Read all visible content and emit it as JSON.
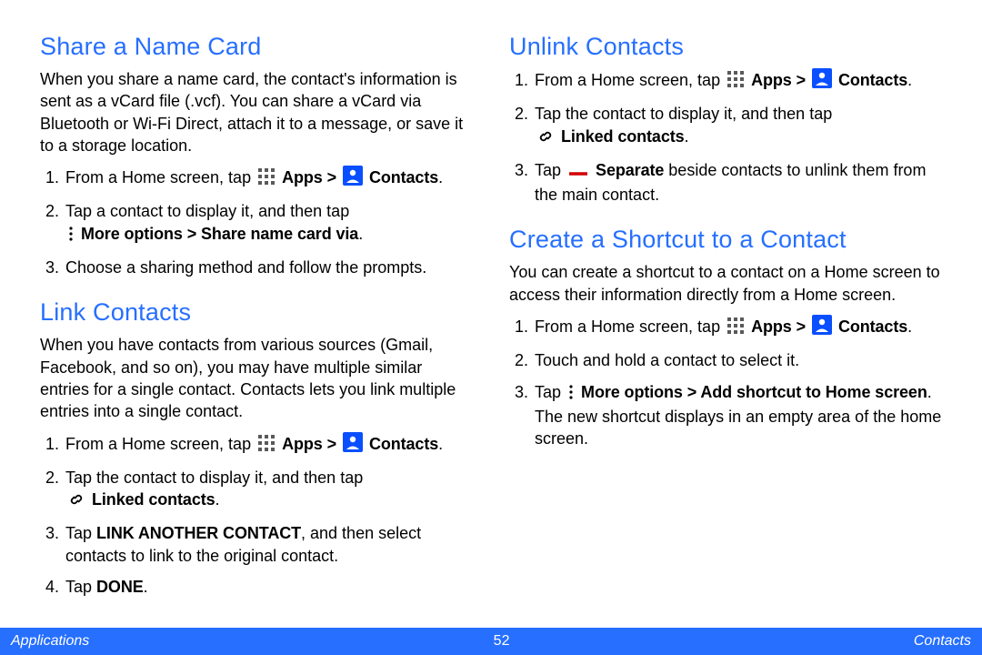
{
  "left": {
    "share": {
      "heading": "Share a Name Card",
      "intro": "When you share a name card, the contact's information is sent as a vCard file (.vcf). You can share a vCard via Bluetooth or Wi-Fi Direct, attach it to a message, or save it to a storage location.",
      "s1_a": "From a Home screen, tap ",
      "s1_b": "Apps > ",
      "s1_c": "Contacts",
      "s1_d": ".",
      "s2_a": "Tap a contact to display it, and then tap ",
      "s2_b": "More options > Share name card via",
      "s2_c": ".",
      "s3": "Choose a sharing method and follow the prompts."
    },
    "link": {
      "heading": "Link Contacts",
      "intro": "When you have contacts from various sources (Gmail, Facebook, and so on), you may have multiple similar entries for a single contact. Contacts lets you link multiple entries into a single contact.",
      "s1_a": "From a Home screen, tap ",
      "s1_b": "Apps > ",
      "s1_c": "Contacts",
      "s1_d": ".",
      "s2_a": "Tap the contact to display it, and then tap ",
      "s2_b": "Linked contacts",
      "s2_c": ".",
      "s3_a": "Tap ",
      "s3_b": "LINK ANOTHER CONTACT",
      "s3_c": ", and then select contacts to link to the original contact.",
      "s4_a": "Tap ",
      "s4_b": "DONE",
      "s4_c": "."
    }
  },
  "right": {
    "unlink": {
      "heading": "Unlink Contacts",
      "s1_a": "From a Home screen, tap ",
      "s1_b": "Apps > ",
      "s1_c": "Contacts",
      "s1_d": ".",
      "s2_a": "Tap the contact to display it, and then tap ",
      "s2_b": "Linked contacts",
      "s2_c": ".",
      "s3_a": "Tap ",
      "s3_b": "Separate",
      "s3_c": " beside contacts to unlink them from the main contact."
    },
    "shortcut": {
      "heading": "Create a Shortcut to a Contact",
      "intro": "You can create a shortcut to a contact on a Home screen to access their information directly from a Home screen.",
      "s1_a": "From a Home screen, tap ",
      "s1_b": "Apps > ",
      "s1_c": "Contacts",
      "s1_d": ".",
      "s2": "Touch and hold a contact to select it.",
      "s3_a": "Tap ",
      "s3_b": "More options > Add shortcut to Home screen",
      "s3_c": ". The new shortcut displays in an empty area of the home screen."
    }
  },
  "footer": {
    "left": "Applications",
    "center": "52",
    "right": "Contacts"
  }
}
